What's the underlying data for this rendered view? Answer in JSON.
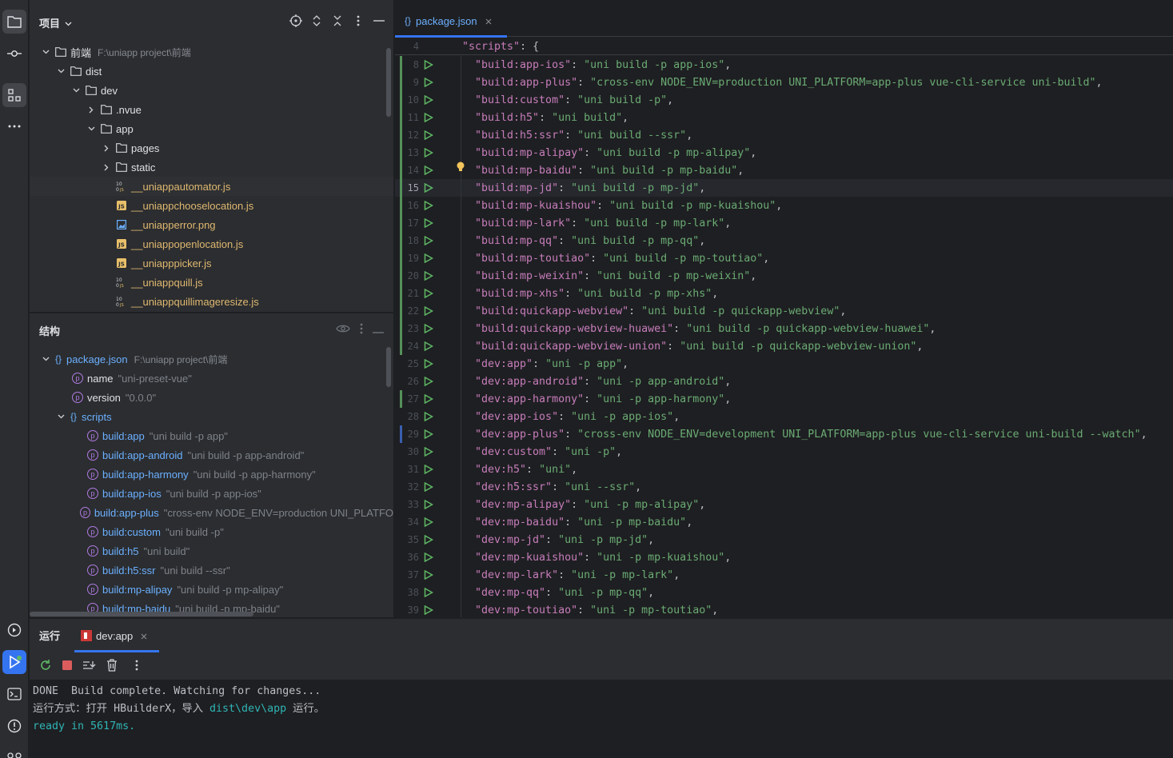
{
  "project_panel": {
    "title": "项目",
    "tree": [
      {
        "level": 0,
        "kind": "folder",
        "open": true,
        "name": "前端",
        "path": "F:\\uniapp project\\前端"
      },
      {
        "level": 1,
        "kind": "folder",
        "open": true,
        "name": "dist"
      },
      {
        "level": 2,
        "kind": "folder",
        "open": true,
        "name": "dev"
      },
      {
        "level": 3,
        "kind": "folder",
        "open": false,
        "name": ".nvue"
      },
      {
        "level": 3,
        "kind": "folder",
        "open": true,
        "name": "app"
      },
      {
        "level": 4,
        "kind": "folder",
        "open": false,
        "name": "pages"
      },
      {
        "level": 4,
        "kind": "folder",
        "open": false,
        "name": "static"
      },
      {
        "level": 4,
        "kind": "binfile",
        "name": "__uniappautomator.js"
      },
      {
        "level": 4,
        "kind": "jsfile",
        "name": "__uniappchooselocation.js"
      },
      {
        "level": 4,
        "kind": "imgfile",
        "name": "__uniapperror.png"
      },
      {
        "level": 4,
        "kind": "jsfile",
        "name": "__uniappopenlocation.js"
      },
      {
        "level": 4,
        "kind": "jsfile",
        "name": "__uniapppicker.js"
      },
      {
        "level": 4,
        "kind": "binfile",
        "name": "__uniappquill.js"
      },
      {
        "level": 4,
        "kind": "binfile",
        "name": "__uniappquillimageresize.js"
      }
    ]
  },
  "structure_panel": {
    "title": "结构",
    "root": {
      "name": "package.json",
      "path": "F:\\uniapp project\\前端"
    },
    "props": [
      {
        "level": 1,
        "key": "name",
        "value": "\"uni-preset-vue\""
      },
      {
        "level": 1,
        "key": "version",
        "value": "\"0.0.0\""
      }
    ],
    "scripts_label": "scripts",
    "scripts": [
      {
        "key": "build:app",
        "value": "\"uni build -p app\""
      },
      {
        "key": "build:app-android",
        "value": "\"uni build -p app-android\""
      },
      {
        "key": "build:app-harmony",
        "value": "\"uni build -p app-harmony\""
      },
      {
        "key": "build:app-ios",
        "value": "\"uni build -p app-ios\""
      },
      {
        "key": "build:app-plus",
        "value": "\"cross-env NODE_ENV=production UNI_PLATFO"
      },
      {
        "key": "build:custom",
        "value": "\"uni build -p\""
      },
      {
        "key": "build:h5",
        "value": "\"uni build\""
      },
      {
        "key": "build:h5:ssr",
        "value": "\"uni build --ssr\""
      },
      {
        "key": "build:mp-alipay",
        "value": "\"uni build -p mp-alipay\""
      },
      {
        "key": "build:mp-baidu",
        "value": "\"uni build -p mp-baidu\""
      }
    ]
  },
  "editor": {
    "tab_label": "package.json",
    "sticky": {
      "line": "4",
      "key": "\"scripts\"",
      "rest": ": {"
    },
    "current_line": "15",
    "lines": [
      {
        "n": "8",
        "key": "\"build:app-ios\"",
        "val": "\"uni build -p app-ios\""
      },
      {
        "n": "9",
        "key": "\"build:app-plus\"",
        "val": "\"cross-env NODE_ENV=production UNI_PLATFORM=app-plus vue-cli-service uni-build\""
      },
      {
        "n": "10",
        "key": "\"build:custom\"",
        "val": "\"uni build -p\""
      },
      {
        "n": "11",
        "key": "\"build:h5\"",
        "val": "\"uni build\""
      },
      {
        "n": "12",
        "key": "\"build:h5:ssr\"",
        "val": "\"uni build --ssr\""
      },
      {
        "n": "13",
        "key": "\"build:mp-alipay\"",
        "val": "\"uni build -p mp-alipay\""
      },
      {
        "n": "14",
        "key": "\"build:mp-baidu\"",
        "val": "\"uni build -p mp-baidu\""
      },
      {
        "n": "15",
        "key": "\"build:mp-jd\"",
        "val": "\"uni build -p mp-jd\""
      },
      {
        "n": "16",
        "key": "\"build:mp-kuaishou\"",
        "val": "\"uni build -p mp-kuaishou\""
      },
      {
        "n": "17",
        "key": "\"build:mp-lark\"",
        "val": "\"uni build -p mp-lark\""
      },
      {
        "n": "18",
        "key": "\"build:mp-qq\"",
        "val": "\"uni build -p mp-qq\""
      },
      {
        "n": "19",
        "key": "\"build:mp-toutiao\"",
        "val": "\"uni build -p mp-toutiao\""
      },
      {
        "n": "20",
        "key": "\"build:mp-weixin\"",
        "val": "\"uni build -p mp-weixin\""
      },
      {
        "n": "21",
        "key": "\"build:mp-xhs\"",
        "val": "\"uni build -p mp-xhs\""
      },
      {
        "n": "22",
        "key": "\"build:quickapp-webview\"",
        "val": "\"uni build -p quickapp-webview\""
      },
      {
        "n": "23",
        "key": "\"build:quickapp-webview-huawei\"",
        "val": "\"uni build -p quickapp-webview-huawei\""
      },
      {
        "n": "24",
        "key": "\"build:quickapp-webview-union\"",
        "val": "\"uni build -p quickapp-webview-union\""
      },
      {
        "n": "25",
        "key": "\"dev:app\"",
        "val": "\"uni -p app\""
      },
      {
        "n": "26",
        "key": "\"dev:app-android\"",
        "val": "\"uni -p app-android\""
      },
      {
        "n": "27",
        "key": "\"dev:app-harmony\"",
        "val": "\"uni -p app-harmony\""
      },
      {
        "n": "28",
        "key": "\"dev:app-ios\"",
        "val": "\"uni -p app-ios\""
      },
      {
        "n": "29",
        "key": "\"dev:app-plus\"",
        "val": "\"cross-env NODE_ENV=development UNI_PLATFORM=app-plus vue-cli-service uni-build --watch\""
      },
      {
        "n": "30",
        "key": "\"dev:custom\"",
        "val": "\"uni -p\""
      },
      {
        "n": "31",
        "key": "\"dev:h5\"",
        "val": "\"uni\""
      },
      {
        "n": "32",
        "key": "\"dev:h5:ssr\"",
        "val": "\"uni --ssr\""
      },
      {
        "n": "33",
        "key": "\"dev:mp-alipay\"",
        "val": "\"uni -p mp-alipay\""
      },
      {
        "n": "34",
        "key": "\"dev:mp-baidu\"",
        "val": "\"uni -p mp-baidu\""
      },
      {
        "n": "35",
        "key": "\"dev:mp-jd\"",
        "val": "\"uni -p mp-jd\""
      },
      {
        "n": "36",
        "key": "\"dev:mp-kuaishou\"",
        "val": "\"uni -p mp-kuaishou\""
      },
      {
        "n": "37",
        "key": "\"dev:mp-lark\"",
        "val": "\"uni -p mp-lark\""
      },
      {
        "n": "38",
        "key": "\"dev:mp-qq\"",
        "val": "\"uni -p mp-qq\""
      },
      {
        "n": "39",
        "key": "\"dev:mp-toutiao\"",
        "val": "\"uni -p mp-toutiao\""
      }
    ]
  },
  "run_panel": {
    "title": "运行",
    "tab_label": "dev:app",
    "console": {
      "line1": "DONE  Build complete. Watching for changes...",
      "line2_prefix": "运行方式：打开 HBuilderX，导入 ",
      "line2_path": "dist\\dev\\app",
      "line2_suffix": " 运行。",
      "line3": "ready in 5617ms."
    }
  },
  "colors": {
    "accent": "#3574f0",
    "string": "#6aab73",
    "key": "#c77dbb",
    "run_green": "#5fb865",
    "console_cyan": "#2fb5b5"
  }
}
